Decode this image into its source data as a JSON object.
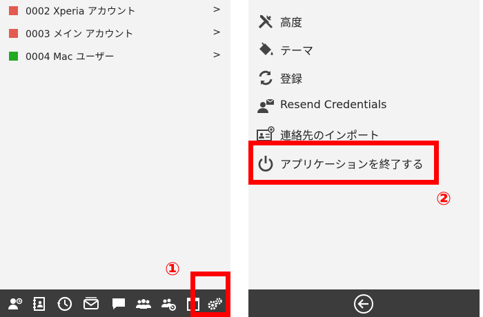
{
  "accounts": [
    {
      "label": "0002 Xperia アカウント",
      "color": "#e35b50"
    },
    {
      "label": "0003 メイン アカウント",
      "color": "#e35b50"
    },
    {
      "label": "0004 Mac ユーザー",
      "color": "#22aa22"
    }
  ],
  "chevron": ">",
  "toolbar_icons": [
    "contact-add-icon",
    "address-book-icon",
    "clock-icon",
    "mail-icon",
    "chat-icon",
    "group-icon",
    "group-settings-icon",
    "calendar-icon",
    "settings-icon"
  ],
  "menu": [
    {
      "label": "高度",
      "icon": "tools-icon"
    },
    {
      "label": "テーマ",
      "icon": "paint-bucket-icon"
    },
    {
      "label": "登録",
      "icon": "sync-icon"
    },
    {
      "label": "Resend Credentials",
      "icon": "user-mail-icon"
    },
    {
      "label": "連絡先のインポート",
      "icon": "contact-card-add-icon"
    },
    {
      "label": "アプリケーションを終了する",
      "icon": "power-icon"
    }
  ],
  "annotations": {
    "one": "①",
    "two": "②"
  },
  "colors": {
    "highlight": "#ff0000",
    "toolbar": "#3c3c3c",
    "panel": "#f3f3f3"
  }
}
